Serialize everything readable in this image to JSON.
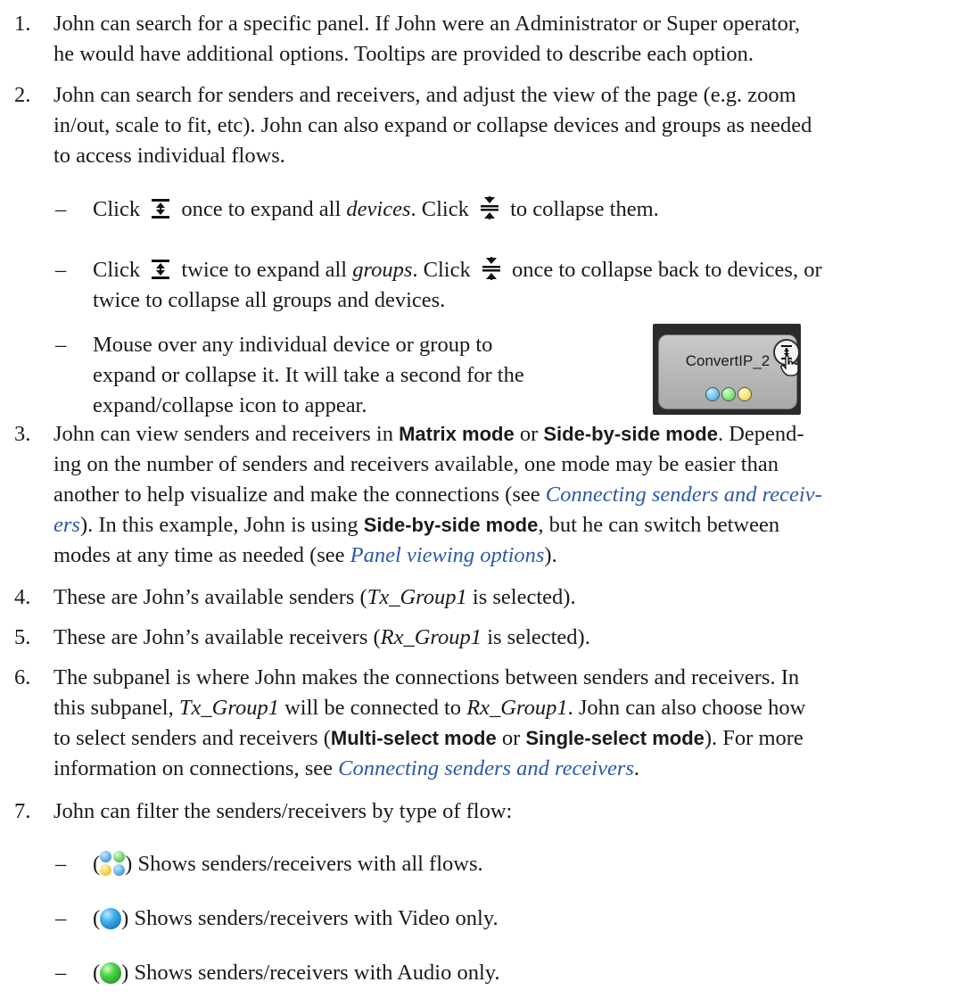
{
  "items": [
    {
      "num": "1.",
      "line1": "John can search for a specific panel. If John were an Administrator or Super operator,",
      "line2": "he would have additional options. Tooltips are provided to describe each option."
    },
    {
      "num": "2.",
      "line1": "John can search for senders and receivers, and adjust the view of the page (e.g. zoom",
      "line2": "in/out, scale to fit, etc). John can also expand or collapse devices and groups as needed",
      "line3": "to access individual flows."
    },
    {
      "num": "3.",
      "line1_a": "John can view senders and receivers in ",
      "line1_b1": "Matrix mode",
      "line1_c": " or ",
      "line1_b2": "Side-by-side mode",
      "line1_d": ". Depend-",
      "line2": "ing on the number of senders and receivers available, one mode may be easier than",
      "line3_a": "another to help visualize and make the connections (see ",
      "line3_link": "Connecting senders and receiv-",
      "line4_link": "ers",
      "line4_a": "). In this example, John is using ",
      "line4_b": "Side-by-side mode",
      "line4_c": ", but he can switch between",
      "line5_a": "modes at any time as needed (see ",
      "line5_link": "Panel viewing options",
      "line5_b": ")."
    },
    {
      "num": "4.",
      "a": "These are John’s available senders (",
      "em": "Tx_Group1",
      "b": " is selected)."
    },
    {
      "num": "5.",
      "a": "These are John’s available receivers (",
      "em": "Rx_Group1",
      "b": " is selected)."
    },
    {
      "num": "6.",
      "line1": "The subpanel is where John makes the connections between senders and receivers. In",
      "line2_a": "this subpanel, ",
      "line2_em1": "Tx_Group1",
      "line2_b": " will be connected to ",
      "line2_em2": "Rx_Group1",
      "line2_c": ". John can also choose how",
      "line3_a": "to select senders and receivers (",
      "line3_b1": "Multi-select mode",
      "line3_c": " or ",
      "line3_b2": "Single-select mode",
      "line3_d": "). For more",
      "line4_a": "information on connections, see ",
      "line4_link": "Connecting senders and receivers",
      "line4_b": "."
    },
    {
      "num": "7.",
      "line1": "John can filter the senders/receivers by type of flow:"
    }
  ],
  "bullets_item2": [
    {
      "dash": "–",
      "a": "Click",
      "b": "once to expand all ",
      "em": "devices",
      "c": ". Click",
      "d": "to collapse them."
    },
    {
      "dash": "–",
      "a": "Click",
      "b": "twice to expand all ",
      "em": "groups",
      "c": ". Click",
      "d": "once to collapse back to devices, or",
      "line2": "twice to collapse all groups and devices."
    },
    {
      "dash": "–",
      "line1": "Mouse over any individual device or group to",
      "line2": "expand or collapse it. It will take a second for the",
      "line3": "expand/collapse icon to appear."
    }
  ],
  "device_thumbnail": {
    "name": "ConvertIP_2"
  },
  "bullets_item7": [
    {
      "dash": "–",
      "open": "(",
      "close": ")",
      "text": " Shows senders/receivers with all flows.",
      "icon": "all-flows-icon"
    },
    {
      "dash": "–",
      "open": "(",
      "close": ")",
      "text": " Shows senders/receivers with Video only.",
      "icon": "video-flow-icon"
    },
    {
      "dash": "–",
      "open": "(",
      "close": ")",
      "text": " Shows senders/receivers with Audio only.",
      "icon": "audio-flow-icon"
    }
  ],
  "colors": {
    "link": "#2b58a8",
    "text": "#1a1a1a"
  }
}
